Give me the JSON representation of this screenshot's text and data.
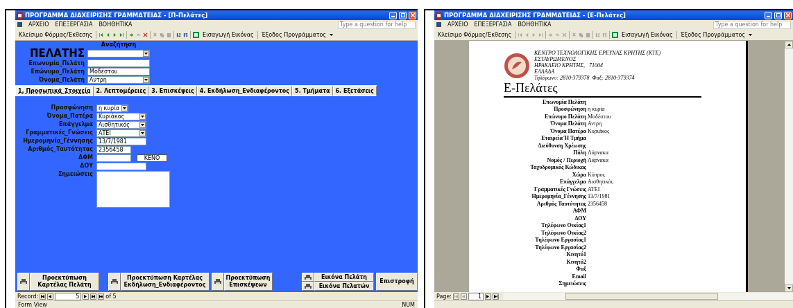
{
  "left_window": {
    "title": "ΠΡΟΓΡΑΜΜΑ ΔΙΑΧΕΙΡΙΣΗΣ ΓΡΑΜΜΑΤΕΙΑΣ - [Π-Πελάτες]",
    "menu": [
      "ΑΡΧΕΙΟ",
      "ΕΠΕΞΕΡΓΑΣΙΑ",
      "ΒΟΗΘΗΤΙΚΑ"
    ],
    "help_placeholder": "Type a question for help",
    "toolbar": {
      "close_label": "Κλείσιμο Φόρμας/Έκθεσης",
      "picture_label": "Εισαγωγή Εικόνας",
      "exit_label": "Έξοδος Προγράμματος",
      "nav_enabled": true
    },
    "form": {
      "heading": "ΠΕΛΑΤΗΣ",
      "search_label": "Αναζήτηση",
      "header_fields": [
        {
          "label": "Επωνυμία_Πελάτη",
          "kind": "text"
        },
        {
          "label": "Επώνυμο_Πελάτη",
          "value": "Μοδέστου",
          "kind": "text"
        },
        {
          "label": "Όνομα_Πελάτη",
          "value": "Αντρη",
          "kind": "combo"
        }
      ],
      "tabs": [
        {
          "label": "1. Προσωπικά_Στοιχεία",
          "selected": true
        },
        {
          "label": "2. Λεπτομέρειες",
          "selected": false
        },
        {
          "label": "3. Επισκέψεις",
          "selected": false
        },
        {
          "label": "4. Εκδήλωση_Ενδιαφέροντος",
          "selected": false
        },
        {
          "label": "5. Τμήματα",
          "selected": false
        },
        {
          "label": "6. Εξετάσεις",
          "selected": false
        }
      ],
      "fields": [
        {
          "label": "Προσφώνηση",
          "value": "η κυρία",
          "kind": "small_combo"
        },
        {
          "label": "Όνομα_Πατέρα",
          "value": "Κυριάκος",
          "kind": "combo"
        },
        {
          "label": "Επάγγελμα",
          "value": "Αισθητικός",
          "kind": "combo"
        },
        {
          "label": "Γραμματικές_Γνώσεις",
          "value": "ΑΤΕΙ",
          "kind": "combo"
        },
        {
          "label": "Ημερομηνία_Γέννησης",
          "value": "13/7/1981",
          "kind": "text"
        },
        {
          "label": "Αριθμός_Ταυτότητας",
          "value": "2356458",
          "kind": "short"
        },
        {
          "label": "ΑΦΜ",
          "kind": "short_button",
          "button": "ΚΕΝΟ"
        },
        {
          "label": "ΔΟΥ",
          "kind": "text"
        },
        {
          "label": "Σημειώσεις",
          "kind": "memo"
        }
      ],
      "buttons": [
        {
          "kind": "print",
          "label": "Προεκτύπωση Καρτέλας Πελάτη"
        },
        {
          "kind": "print",
          "label": "Προεκτύπωση Καρτέλας Εκδήλωση_Ενδιαφέροντος"
        },
        {
          "kind": "print",
          "label": "Προεκτύπωση Επισκέψεων"
        },
        {
          "kind": "print_pair",
          "labels": [
            "Εικόνα Πελάτη",
            "Εικόνα Πελατών"
          ]
        },
        {
          "kind": "plain",
          "label": "Επιστροφή"
        }
      ]
    },
    "record_nav": {
      "label": "Record:",
      "current": "5",
      "total": "of 5"
    },
    "status": {
      "left": "Form View",
      "right": "NUM"
    }
  },
  "right_window": {
    "title": "ΠΡΟΓΡΑΜΜΑ ΔΙΑΧΕΙΡΙΣΗΣ ΓΡΑΜΜΑΤΕΙΑΣ - [Ε-Πελάτες]",
    "menu": [
      "ΑΡΧΕΙΟ",
      "ΕΠΕΞΕΡΓΑΣΙΑ",
      "ΒΟΗΘΗΤΙΚΑ"
    ],
    "help_placeholder": "Type a question for help",
    "toolbar": {
      "close_label": "Κλείσιμο Φόρμας/Έκθεσης",
      "picture_label": "Εισαγωγή Εικόνας",
      "exit_label": "Έξοδος Προγράμματος",
      "nav_enabled": false
    },
    "report": {
      "org_lines": [
        "ΚΕΝΤΡΟ ΤΕΧΝΟΛΟΓΙΚΗΣ ΕΡΕΥΝΑΣ ΚΡΗΤΗΣ (ΚΤΕ)",
        "ΕΣΤΑΥΡΩΜΕΝΟΣ",
        "ΗΡΑΚΛΕΙΟ ΚΡΗΤΗΣ,   71004",
        "ΕΛΛΑΔΑ",
        "Τηλέφωνο: 2810-379378  Φαξ: 2810-379374"
      ],
      "title": "Ε-Πελάτες",
      "rows": [
        {
          "label": "Επωνυμία Πελάτη"
        },
        {
          "label": "Προσφώνηση",
          "value": "η κυρία"
        },
        {
          "label": "Επώνυμο Πελάτη",
          "value": "Μοδέστου"
        },
        {
          "label": "Όνομα Πελάτη",
          "value": "Αντρη"
        },
        {
          "label": "Όνομα Πατέρα",
          "value": "Κυριάκος"
        },
        {
          "label": "Εταιρεία Ή Τμήμα"
        },
        {
          "label": "Διεύθυνση Χρέωσης"
        },
        {
          "label": "Πόλη",
          "value": "Λάρνακα"
        },
        {
          "label": "Νομός / Περιοχή",
          "value": "Λάρνακα"
        },
        {
          "label": "Ταχυδρομικός Κώδικας"
        },
        {
          "label": "Χώρα",
          "value": "Κύπρος"
        },
        {
          "label": "Επάγγελμα",
          "value": "Αισθητικός"
        },
        {
          "label": "Γραμματικές Γνώσεις",
          "value": "ΑΤΕΙ"
        },
        {
          "label": "Ημερομηνία_Γέννησης",
          "value": "13/7/1981"
        },
        {
          "label": "Αριθμός Ταυτότητας",
          "value": "2356458"
        },
        {
          "label": "ΑΦΜ"
        },
        {
          "label": "ΔΟΥ"
        },
        {
          "label": "Τηλέφωνο Οικίας1"
        },
        {
          "label": "Τηλέφωνο Οικίας2"
        },
        {
          "label": "Τηλέφωνο Εργασίας1"
        },
        {
          "label": "Τηλέφωνο Εργασίας2"
        },
        {
          "label": "Κινητό1"
        },
        {
          "label": "Κινητό2"
        },
        {
          "label": "Φαξ"
        },
        {
          "label": "Email"
        },
        {
          "label": "Σημειώσεις"
        }
      ]
    },
    "page_nav": {
      "label": "Page:",
      "current": "1"
    }
  }
}
